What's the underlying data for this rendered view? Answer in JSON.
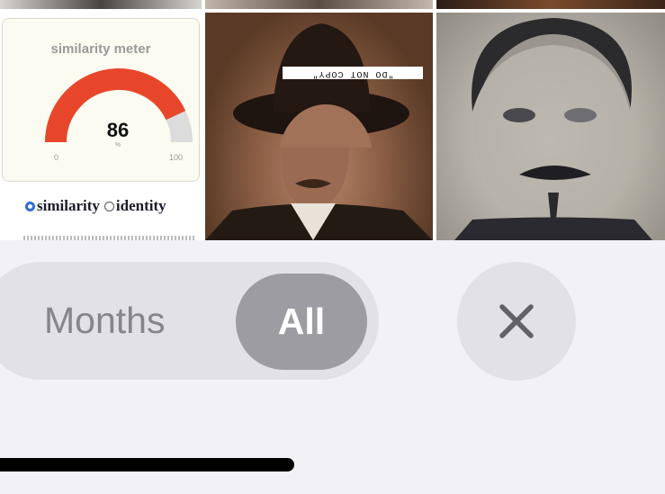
{
  "photo_grid": {
    "meter_tile": {
      "title": "similarity meter",
      "value": "86",
      "unit": "%",
      "min_label": "0",
      "max_label": "100",
      "fill_fraction": 0.86,
      "fill_color": "#e8462a",
      "track_color": "#dcdcdc",
      "options": [
        {
          "label": "similarity",
          "selected": true
        },
        {
          "label": "identity",
          "selected": false
        }
      ]
    },
    "photo1": {
      "watermark": "\"DO NOT COPY\""
    }
  },
  "segmented_control": {
    "months_label": "Months",
    "all_label": "All",
    "selected": "All"
  },
  "colors": {
    "background": "#f2f1f6",
    "segment_track": "#e2e1e6",
    "segment_selected": "#9d9ca2",
    "radio_accent": "#2f6fd1"
  },
  "icons": {
    "close": "close-icon"
  }
}
